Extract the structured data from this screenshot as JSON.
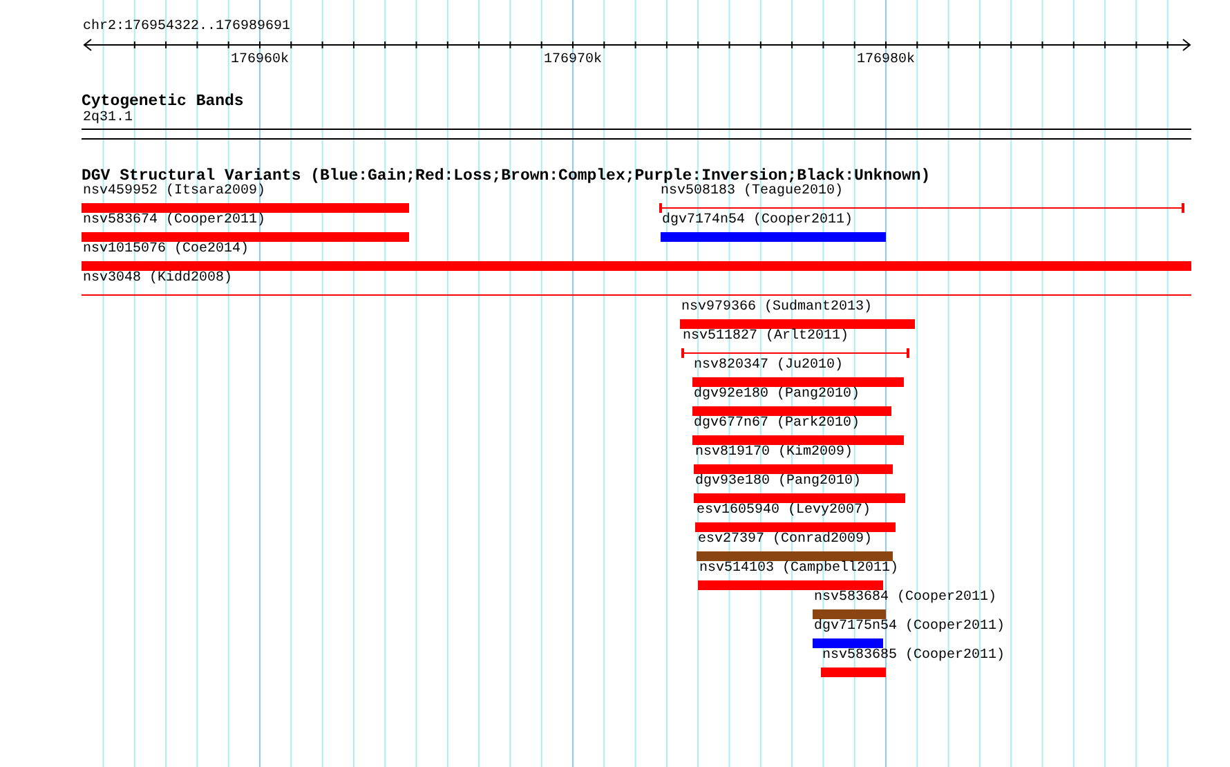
{
  "ruler": {
    "position": "chr2:176954322..176989691",
    "ticks": [
      "176960k",
      "176970k",
      "176980k"
    ]
  },
  "cytoband_track": {
    "title": "Cytogenetic Bands",
    "band": "2q31.1"
  },
  "variant_track": {
    "title": "DGV Structural Variants (Blue:Gain;Red:Loss;Brown:Complex;Purple:Inversion;Black:Unknown)",
    "variants": [
      {
        "label": "nsv459952 (Itsara2009)",
        "kind": "bar",
        "color": "#ff0000"
      },
      {
        "label": "nsv508183 (Teague2010)",
        "kind": "capped-line",
        "color": "#ff0000"
      },
      {
        "label": "nsv583674 (Cooper2011)",
        "kind": "bar",
        "color": "#ff0000"
      },
      {
        "label": "dgv7174n54 (Cooper2011)",
        "kind": "bar",
        "color": "#0000ff"
      },
      {
        "label": "nsv1015076 (Coe2014)",
        "kind": "bar",
        "color": "#ff0000"
      },
      {
        "label": "nsv3048 (Kidd2008)",
        "kind": "line",
        "color": "#ff0000"
      },
      {
        "label": "nsv979366 (Sudmant2013)",
        "kind": "bar",
        "color": "#ff0000"
      },
      {
        "label": "nsv511827 (Arlt2011)",
        "kind": "capped-line",
        "color": "#ff0000"
      },
      {
        "label": "nsv820347 (Ju2010)",
        "kind": "bar",
        "color": "#ff0000"
      },
      {
        "label": "dgv92e180 (Pang2010)",
        "kind": "bar",
        "color": "#ff0000"
      },
      {
        "label": "dgv677n67 (Park2010)",
        "kind": "bar",
        "color": "#ff0000"
      },
      {
        "label": "nsv819170 (Kim2009)",
        "kind": "bar",
        "color": "#ff0000"
      },
      {
        "label": "dgv93e180 (Pang2010)",
        "kind": "bar",
        "color": "#ff0000"
      },
      {
        "label": "esv1605940 (Levy2007)",
        "kind": "bar",
        "color": "#ff0000"
      },
      {
        "label": "esv27397 (Conrad2009)",
        "kind": "bar",
        "color": "#8b4513"
      },
      {
        "label": "nsv514103 (Campbell2011)",
        "kind": "bar",
        "color": "#ff0000"
      },
      {
        "label": "nsv583684 (Cooper2011)",
        "kind": "bar",
        "color": "#8b4513"
      },
      {
        "label": "dgv7175n54 (Cooper2011)",
        "kind": "bar",
        "color": "#0000ff"
      },
      {
        "label": "nsv583685 (Cooper2011)",
        "kind": "bar",
        "color": "#ff0000"
      }
    ]
  }
}
